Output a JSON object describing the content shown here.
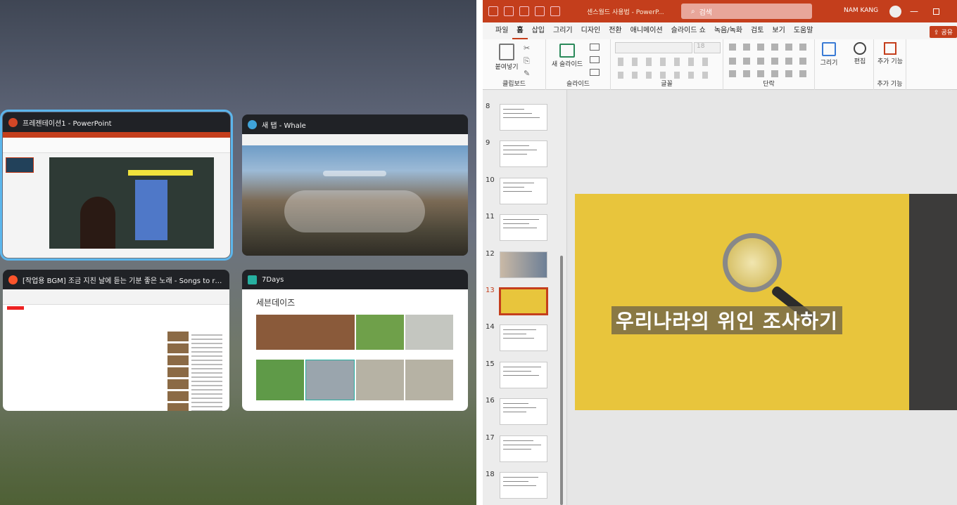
{
  "snap_assist": {
    "windows": [
      {
        "title": "프레젠테이션1 - PowerPoint",
        "icon": "powerpoint-icon",
        "selected": true
      },
      {
        "title": "새 탭 - Whale",
        "icon": "whale-icon"
      },
      {
        "title": "[작업용 BGM] 조금 지친 날에 듣는 기분 좋은 노래 - Songs to relieve s...",
        "icon": "brave-icon"
      },
      {
        "title": "7Days",
        "icon": "7days-icon",
        "content_title": "세븐데이즈"
      }
    ]
  },
  "powerpoint": {
    "doc_title": "센스월드 사용법 - PowerP...",
    "search_placeholder": "검색",
    "user_name": "NAM KANG",
    "minimize_glyph": "—",
    "menu_tabs": [
      "파일",
      "홈",
      "삽입",
      "그리기",
      "디자인",
      "전환",
      "애니메이션",
      "슬라이드 쇼",
      "녹음/녹화",
      "검토",
      "보기",
      "도움말"
    ],
    "active_tab": "홈",
    "share_label": "공유",
    "ribbon": {
      "paste_label": "붙여넣기",
      "clipboard_label": "클립보드",
      "new_slide_label": "새 슬라이드",
      "slide_label": "슬라이드",
      "font_size": "18",
      "font_label": "글꼴",
      "paragraph_label": "단락",
      "draw_label": "그리기",
      "edit_label": "편집",
      "addin_label": "추가 기능",
      "addin_group_label": "추가 기능"
    },
    "slides": [
      {
        "num": "8"
      },
      {
        "num": "9"
      },
      {
        "num": "10"
      },
      {
        "num": "11"
      },
      {
        "num": "12"
      },
      {
        "num": "13",
        "current": true
      },
      {
        "num": "14"
      },
      {
        "num": "15"
      },
      {
        "num": "16"
      },
      {
        "num": "17"
      },
      {
        "num": "18"
      }
    ],
    "current_slide_title": "우리나라의 위인 조사하기"
  },
  "colors": {
    "accent": "#c43e1c",
    "selection": "#5cb6ec",
    "slide_bg": "#e8c53c"
  }
}
